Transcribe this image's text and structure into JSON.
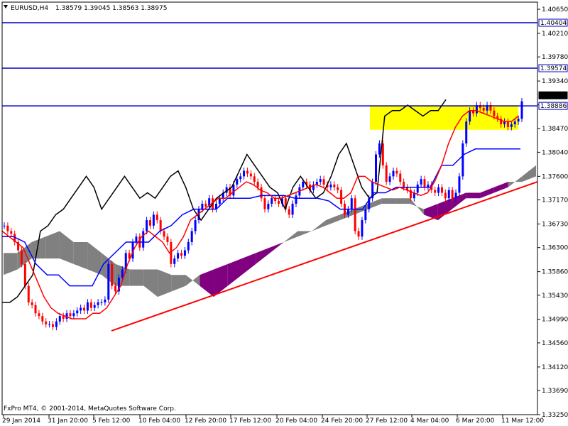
{
  "header": {
    "symbol": "EURUSD,H4",
    "ohlc": "1.38579 1.39045 1.38563 1.38975",
    "menu_icon": "triangle-down-icon"
  },
  "footer": {
    "copyright": "FxPro MT4, © 2001-2014, MetaQuotes Software Corp."
  },
  "colors": {
    "background": "#ffffff",
    "candle_up": "#0000ff",
    "candle_down": "#ff0000",
    "tenkan": "#ff0000",
    "kijun": "#0000ff",
    "chikou": "#000000",
    "kumo_bull": "#808080",
    "kumo_bear": "#800080",
    "hline": "#0000cc",
    "trendline": "#ff0000",
    "highlight": "#ffff00",
    "grid": "#c0c0c0"
  },
  "chart_data": {
    "type": "candlestick",
    "symbol": "EURUSD",
    "timeframe": "H4",
    "ylim": [
      1.3325,
      1.4078
    ],
    "y_ticks": [
      "1.40650",
      "1.40210",
      "1.39780",
      "1.39340",
      "1.38910",
      "1.38470",
      "1.38040",
      "1.37600",
      "1.37170",
      "1.36730",
      "1.36300",
      "1.35860",
      "1.35430",
      "1.34990",
      "1.34560",
      "1.34120",
      "1.33690",
      "1.33250"
    ],
    "x_ticks": [
      "29 Jan 2014",
      "31 Jan 20:00",
      "5 Feb 12:00",
      "10 Feb 04:00",
      "12 Feb 20:00",
      "17 Feb 12:00",
      "20 Feb 04:00",
      "24 Feb 20:00",
      "27 Feb 12:00",
      "4 Mar 04:00",
      "6 Mar 20:00",
      "11 Mar 12:00"
    ],
    "price_labels": [
      {
        "value": 1.40404,
        "text": "1.40404",
        "kind": "hline"
      },
      {
        "value": 1.39574,
        "text": "1.39574",
        "kind": "hline"
      },
      {
        "value": 1.38886,
        "text": "1.38886",
        "kind": "hline"
      },
      {
        "value": 1.38975,
        "text": "1.38975",
        "kind": "current"
      }
    ],
    "close": [
      1.367,
      1.366,
      1.3655,
      1.364,
      1.3625,
      1.36,
      1.356,
      1.353,
      1.3525,
      1.351,
      1.3505,
      1.3495,
      1.349,
      1.349,
      1.3485,
      1.3495,
      1.3505,
      1.35,
      1.351,
      1.3505,
      1.351,
      1.3515,
      1.352,
      1.3515,
      1.353,
      1.352,
      1.3525,
      1.353,
      1.353,
      1.3535,
      1.36,
      1.356,
      1.355,
      1.3575,
      1.359,
      1.362,
      1.361,
      1.364,
      1.365,
      1.363,
      1.366,
      1.368,
      1.367,
      1.369,
      1.368,
      1.366,
      1.365,
      1.364,
      1.36,
      1.361,
      1.362,
      1.3615,
      1.3625,
      1.364,
      1.366,
      1.368,
      1.37,
      1.371,
      1.3705,
      1.372,
      1.37,
      1.371,
      1.372,
      1.373,
      1.374,
      1.3725,
      1.3745,
      1.3755,
      1.376,
      1.377,
      1.3765,
      1.376,
      1.375,
      1.374,
      1.372,
      1.37,
      1.371,
      1.372,
      1.3715,
      1.371,
      1.372,
      1.37,
      1.369,
      1.371,
      1.3725,
      1.374,
      1.375,
      1.3745,
      1.3735,
      1.3745,
      1.375,
      1.3755,
      1.3745,
      1.374,
      1.3745,
      1.374,
      1.3735,
      1.371,
      1.369,
      1.37,
      1.372,
      1.366,
      1.365,
      1.368,
      1.37,
      1.372,
      1.375,
      1.38,
      1.382,
      1.378,
      1.375,
      1.376,
      1.377,
      1.3765,
      1.375,
      1.374,
      1.3735,
      1.372,
      1.373,
      1.3745,
      1.3755,
      1.374,
      1.3745,
      1.3735,
      1.373,
      1.374,
      1.373,
      1.372,
      1.3735,
      1.372,
      1.373,
      1.376,
      1.382,
      1.386,
      1.388,
      1.3875,
      1.389,
      1.3885,
      1.388,
      1.389,
      1.388,
      1.387,
      1.3865,
      1.3855,
      1.386,
      1.385,
      1.3855,
      1.386,
      1.3865,
      1.3897
    ],
    "tenkan": [
      1.366,
      1.365,
      1.364,
      1.363,
      1.36,
      1.357,
      1.354,
      1.352,
      1.351,
      1.3505,
      1.35,
      1.35,
      1.35,
      1.351,
      1.351,
      1.352,
      1.354,
      1.356,
      1.36,
      1.363,
      1.365,
      1.366,
      1.365,
      1.364,
      1.362,
      1.363,
      1.365,
      1.368,
      1.369,
      1.37,
      1.371,
      1.372,
      1.372,
      1.373,
      1.374,
      1.375,
      1.3745,
      1.3735,
      1.373,
      1.372,
      1.372,
      1.3725,
      1.373,
      1.3735,
      1.374,
      1.3745,
      1.374,
      1.373,
      1.372,
      1.372,
      1.373,
      1.376,
      1.376,
      1.375,
      1.3745,
      1.374,
      1.3735,
      1.374,
      1.3735,
      1.373,
      1.3725,
      1.373,
      1.375,
      1.378,
      1.382,
      1.385,
      1.387,
      1.388,
      1.388,
      1.3875,
      1.387,
      1.3865,
      1.386,
      1.386,
      1.387
    ],
    "kijun": [
      1.365,
      1.365,
      1.364,
      1.36,
      1.358,
      1.358,
      1.356,
      1.356,
      1.356,
      1.36,
      1.362,
      1.364,
      1.364,
      1.364,
      1.366,
      1.367,
      1.369,
      1.37,
      1.37,
      1.37,
      1.372,
      1.372,
      1.372,
      1.3725,
      1.3725,
      1.3725,
      1.372,
      1.372,
      1.372,
      1.3715,
      1.37,
      1.37,
      1.37,
      1.373,
      1.373,
      1.374,
      1.374,
      1.374,
      1.374,
      1.378,
      1.378,
      1.38,
      1.381,
      1.381,
      1.381,
      1.381,
      1.381
    ],
    "chikou": [
      1.353,
      1.353,
      1.354,
      1.356,
      1.358,
      1.366,
      1.367,
      1.369,
      1.37,
      1.372,
      1.374,
      1.376,
      1.374,
      1.37,
      1.372,
      1.374,
      1.376,
      1.374,
      1.372,
      1.373,
      1.372,
      1.374,
      1.376,
      1.377,
      1.374,
      1.37,
      1.368,
      1.37,
      1.372,
      1.373,
      1.374,
      1.377,
      1.38,
      1.378,
      1.376,
      1.374,
      1.373,
      1.37,
      1.374,
      1.376,
      1.374,
      1.372,
      1.373,
      1.376,
      1.38,
      1.382,
      1.378,
      1.374,
      1.372,
      1.373,
      1.387,
      1.388,
      1.388,
      1.389,
      1.388,
      1.387,
      1.388,
      1.388,
      1.39
    ],
    "kumo": {
      "span_a": [
        1.362,
        1.362,
        1.364,
        1.365,
        1.366,
        1.364,
        1.364,
        1.362,
        1.36,
        1.359,
        1.359,
        1.359,
        1.358,
        1.358,
        1.356,
        1.354,
        1.356,
        1.358,
        1.36,
        1.362,
        1.364,
        1.366,
        1.366,
        1.368,
        1.369,
        1.37,
        1.371,
        1.372,
        1.372,
        1.372,
        1.369,
        1.368,
        1.37,
        1.372,
        1.372,
        1.373,
        1.374,
        1.376,
        1.378
      ],
      "span_b": [
        1.358,
        1.359,
        1.361,
        1.361,
        1.361,
        1.36,
        1.359,
        1.358,
        1.356,
        1.356,
        1.356,
        1.354,
        1.355,
        1.356,
        1.358,
        1.359,
        1.36,
        1.361,
        1.362,
        1.363,
        1.364,
        1.365,
        1.366,
        1.367,
        1.368,
        1.369,
        1.37,
        1.371,
        1.371,
        1.371,
        1.37,
        1.371,
        1.372,
        1.373,
        1.373,
        1.374,
        1.375,
        1.375,
        1.376
      ]
    },
    "hlines": [
      1.40404,
      1.39574,
      1.38886
    ],
    "trendline": {
      "from": 1.3478,
      "to": 1.375
    },
    "highlight_rect": {
      "top": 1.389,
      "bottom": 1.3845
    }
  }
}
